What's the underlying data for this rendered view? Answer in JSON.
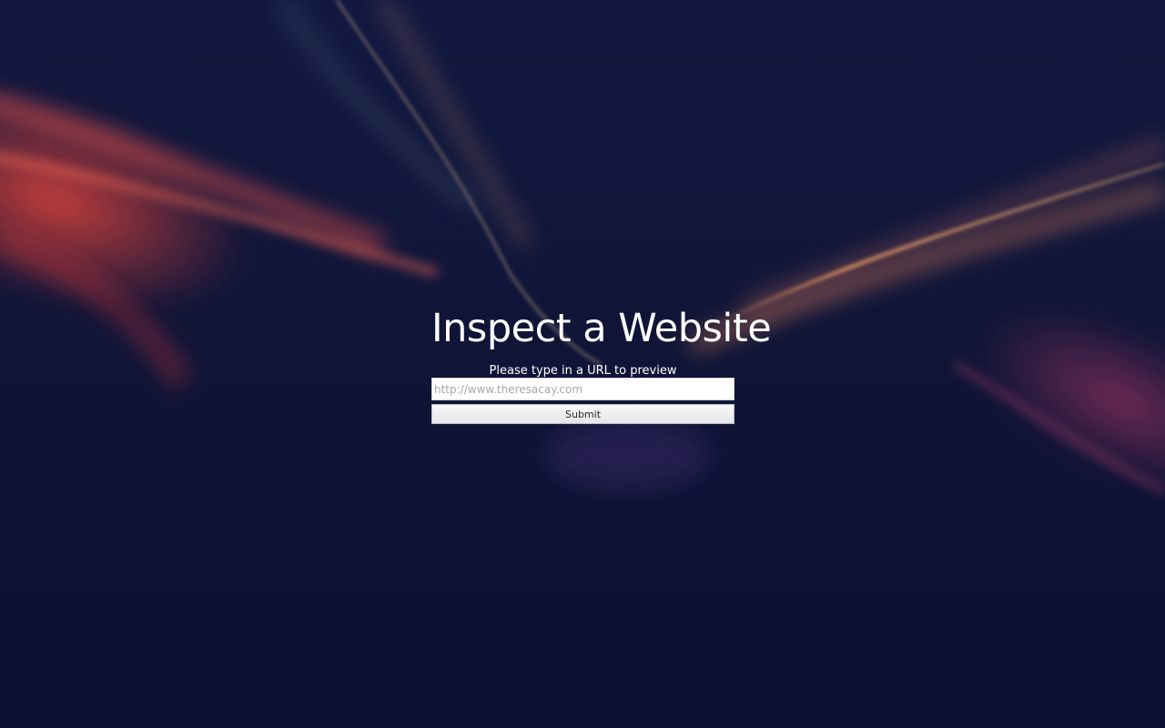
{
  "page": {
    "title": "Inspect a Website",
    "subtitle": "Please type in a URL to preview"
  },
  "form": {
    "url_placeholder": "http://www.theresacay.com",
    "url_value": "",
    "submit_label": "Submit"
  },
  "colors": {
    "background": "#0d1236",
    "text": "#ffffff",
    "accent_red": "#d83a2e",
    "accent_orange": "#f0a35a",
    "accent_purple": "#7a3c86"
  }
}
